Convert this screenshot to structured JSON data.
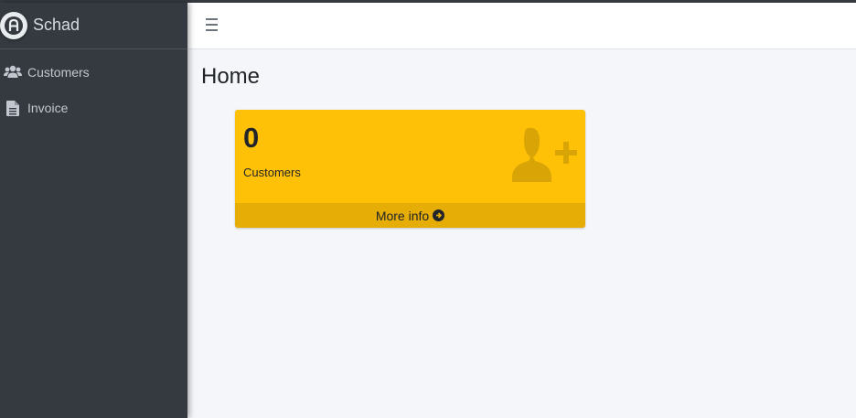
{
  "brand": {
    "name": "Schad",
    "logo_icon": "app-logo-icon"
  },
  "sidebar": {
    "items": [
      {
        "label": "Customers",
        "icon": "users-icon"
      },
      {
        "label": "Invoice",
        "icon": "file-text-icon"
      }
    ]
  },
  "header": {
    "menu_icon": "hamburger-menu-icon"
  },
  "main": {
    "title": "Home",
    "cards": [
      {
        "count": "0",
        "label": "Customers",
        "footer_label": "More info",
        "icon": "user-plus-icon",
        "footer_icon": "arrow-circle-right-icon",
        "color": "#ffc107"
      }
    ]
  },
  "colors": {
    "sidebar_bg": "#343a40",
    "page_bg": "#f4f6f9",
    "card_bg": "#ffc107",
    "card_footer_bg": "#e5ad06"
  }
}
